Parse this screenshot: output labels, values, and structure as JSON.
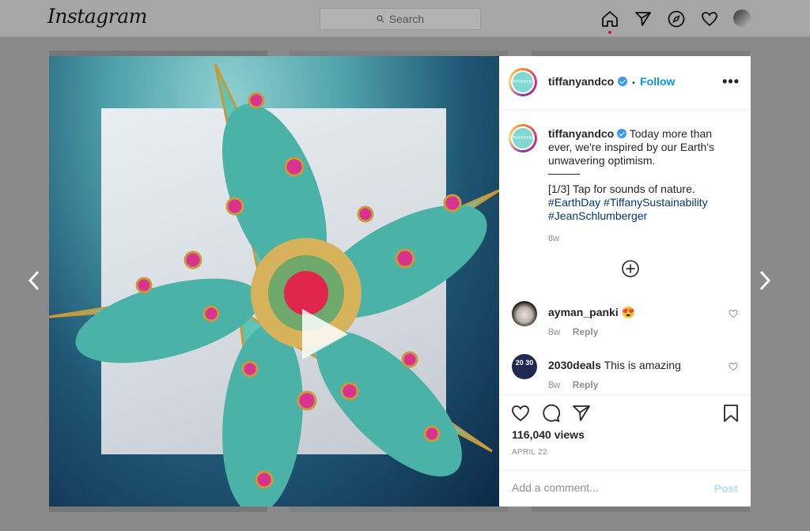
{
  "app": {
    "logo": "Instagram"
  },
  "search": {
    "placeholder": "Search"
  },
  "post": {
    "username": "tiffanyandco",
    "follow_label": "Follow",
    "separator": "•",
    "more_label": "•••",
    "avatar_text": "TIFFANY&CO.",
    "caption": {
      "text": "Today more than ever, we're inspired by our Earth's unwavering optimism.",
      "line2": "[1/3] Tap for sounds of nature.",
      "hashtags": [
        "#EarthDay",
        "#TiffanySustainability",
        "#JeanSchlumberger"
      ],
      "time": "8w"
    },
    "comments": [
      {
        "username": "ayman_panki",
        "text": "😍",
        "time": "8w",
        "reply_label": "Reply"
      },
      {
        "username": "2030deals",
        "text": "This is amazing",
        "time": "8w",
        "reply_label": "Reply",
        "avatar_text": "20 30"
      }
    ],
    "views": "116,040 views",
    "date": "APRIL 22",
    "add_comment_placeholder": "Add a comment...",
    "post_label": "Post"
  },
  "icons": [
    "search-icon",
    "home-icon",
    "direct-icon",
    "explore-icon",
    "activity-icon",
    "play-icon",
    "add-icon",
    "like-icon",
    "comment-icon",
    "share-icon",
    "save-icon",
    "chevron-left-icon",
    "chevron-right-icon"
  ],
  "colors": {
    "accent": "#0095f6",
    "verified": "#3897f0",
    "hashtag": "#00376b",
    "tiffany": "#81d8d0"
  }
}
